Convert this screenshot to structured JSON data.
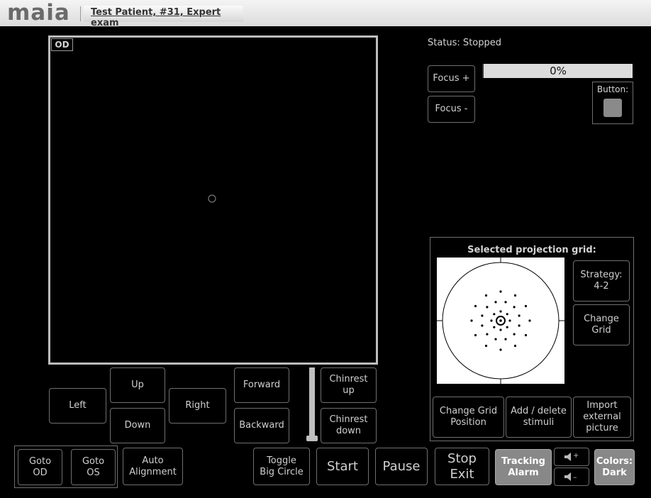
{
  "app": {
    "logo": "maia",
    "patient_tab": "Test Patient, #31, Expert exam"
  },
  "viewer": {
    "eye_label": "OD"
  },
  "status": {
    "text": "Status: Stopped",
    "progress_text": "0%",
    "progress": 0
  },
  "focus": {
    "plus": "Focus +",
    "minus": "Focus -"
  },
  "hw_button": {
    "label": "Button:"
  },
  "grid_panel": {
    "title": "Selected projection grid:",
    "strategy": "Strategy:\n4-2",
    "change_grid": "Change\nGrid",
    "change_pos": "Change Grid\nPosition",
    "add_delete": "Add / delete\nstimuli",
    "import": "Import\nexternal\npicture"
  },
  "motion": {
    "up": "Up",
    "down": "Down",
    "left": "Left",
    "right": "Right",
    "forward": "Forward",
    "backward": "Backward",
    "chin_up": "Chinrest\nup",
    "chin_down": "Chinrest\ndown"
  },
  "bottom": {
    "goto_od": "Goto\nOD",
    "goto_os": "Goto\nOS",
    "auto_align": "Auto\nAlignment",
    "toggle": "Toggle\nBig Circle",
    "start": "Start",
    "pause": "Pause",
    "stop": "Stop\nExit",
    "tracking": "Tracking\nAlarm",
    "colors": "Colors:\nDark"
  }
}
